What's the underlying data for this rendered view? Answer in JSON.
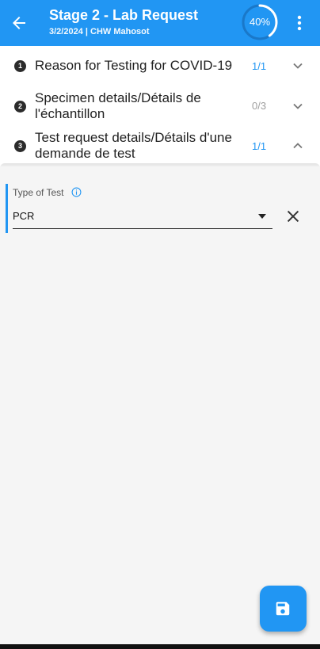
{
  "header": {
    "title": "Stage 2 - Lab Request",
    "subtitle": "3/2/2024 | CHW Mahosot",
    "progress_label": "40%",
    "progress_value": 0.4,
    "accent_color": "#2196f3"
  },
  "sections": [
    {
      "number": "1",
      "title": "Reason for Testing for COVID-19",
      "count": "1/1",
      "state": "collapsed"
    },
    {
      "number": "2",
      "title": "Specimen details/Détails de l'échantillon",
      "count": "0/3",
      "state": "collapsed"
    },
    {
      "number": "3",
      "title": "Test request details/Détails d'une demande de test",
      "count": "1/1",
      "state": "expanded"
    }
  ],
  "form": {
    "field_label": "Type of Test",
    "field_value": "PCR"
  },
  "icons": {
    "back": "arrow-left-icon",
    "menu": "more-vert-icon",
    "info": "info-icon",
    "clear": "close-icon",
    "save": "save-icon"
  }
}
